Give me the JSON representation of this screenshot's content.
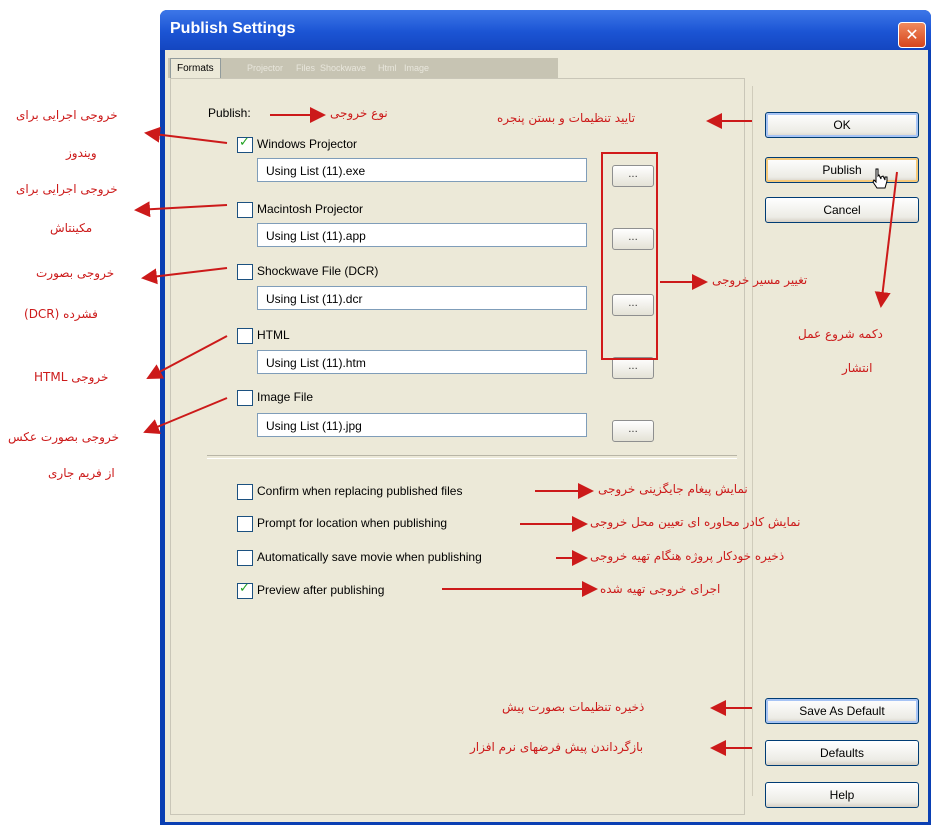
{
  "window": {
    "title": "Publish Settings",
    "close_glyph": "✕",
    "tabs": [
      "Formats",
      "Projector",
      "Files",
      "Shockwave",
      "Html",
      "Image"
    ]
  },
  "publish": {
    "label": "Publish:",
    "formats": [
      {
        "label": "Windows Projector",
        "checked": true,
        "path": "Using List (11).exe"
      },
      {
        "label": "Macintosh Projector",
        "checked": false,
        "path": "Using List (11).app"
      },
      {
        "label": "Shockwave File (DCR)",
        "checked": false,
        "path": "Using List (11).dcr"
      },
      {
        "label": "HTML",
        "checked": false,
        "path": "Using List (11).htm"
      },
      {
        "label": "Image File",
        "checked": false,
        "path": "Using List (11).jpg"
      }
    ],
    "browse_glyph": "..."
  },
  "options": [
    {
      "label": "Confirm when replacing published files",
      "checked": false
    },
    {
      "label": "Prompt for location when publishing",
      "checked": false
    },
    {
      "label": "Automatically save movie when publishing",
      "checked": false
    },
    {
      "label": "Preview after publishing",
      "checked": true
    }
  ],
  "buttons": {
    "ok": "OK",
    "publish": "Publish",
    "cancel": "Cancel",
    "save_as_default": "Save As Default",
    "defaults": "Defaults",
    "help": "Help"
  },
  "annotations": {
    "output_type": "نوع خروجی",
    "ok_confirm": "تایید تنظیمات و بستن پنجره",
    "change_path": "تغییر مسیر خروجی",
    "publish_button_1": "دکمه شروع عمل",
    "publish_button_2": "انتشار",
    "windows_exe_1": "خروجی اجرایی برای",
    "windows_exe_2": "ویندوز",
    "mac_exe_1": "خروجی اجرایی برای",
    "mac_exe_2": "مکینتاش",
    "dcr_1": "خروجی بصورت",
    "dcr_2": "فشرده (DCR)",
    "html_out": "خروجی HTML",
    "image_1": "خروجی بصورت عکس",
    "image_2": "از فریم جاری",
    "confirm_replace": "نمایش پیغام جایگزینی خروجی",
    "prompt_location": "نمایش کادر محاوره ای تعیین محل خروجی",
    "autosave": "ذخیره خودکار پروژه هنگام تهیه خروجی",
    "preview": "اجرای خروجی تهیه شده",
    "save_default": "ذخیره تنظیمات بصورت پیش",
    "restore_defaults": "بازگرداندن پیش فرضهای نرم افزار"
  },
  "colors": {
    "annotation": "#cc1a1a",
    "titlebar": "#1b54d4",
    "dialog_bg": "#ece9d8",
    "check": "#21a121"
  }
}
